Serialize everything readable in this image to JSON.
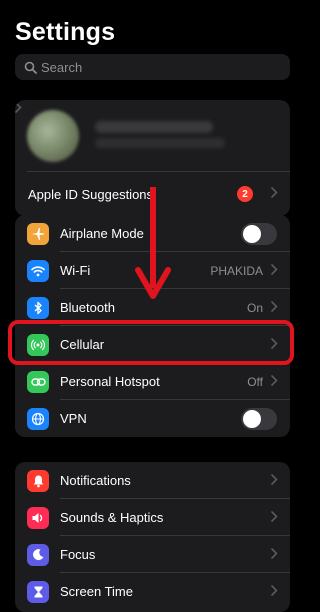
{
  "header": {
    "title": "Settings"
  },
  "search": {
    "placeholder": "Search"
  },
  "profile": {
    "suggestions_label": "Apple ID Suggestions",
    "badge": "2"
  },
  "connectivity": [
    {
      "label": "Airplane Mode",
      "icon": "airplane-icon",
      "color": "#f2a33a",
      "control": "toggle",
      "toggle_on": false
    },
    {
      "label": "Wi-Fi",
      "icon": "wifi-icon",
      "color": "#1a84ff",
      "value": "PHAKIDA"
    },
    {
      "label": "Bluetooth",
      "icon": "bluetooth-icon",
      "color": "#1a84ff",
      "value": "On"
    },
    {
      "label": "Cellular",
      "icon": "antenna-icon",
      "color": "#34c759"
    },
    {
      "label": "Personal Hotspot",
      "icon": "link-icon",
      "color": "#34c759",
      "value": "Off"
    },
    {
      "label": "VPN",
      "icon": "globe-icon",
      "color": "#1a84ff",
      "control": "toggle",
      "toggle_on": false
    }
  ],
  "general": [
    {
      "label": "Notifications",
      "icon": "bell-icon",
      "color": "#ff3b30"
    },
    {
      "label": "Sounds & Haptics",
      "icon": "speaker-icon",
      "color": "#ff2d55"
    },
    {
      "label": "Focus",
      "icon": "moon-icon",
      "color": "#5e5ce6"
    },
    {
      "label": "Screen Time",
      "icon": "hourglass-icon",
      "color": "#5e5ce6"
    }
  ],
  "annotation": {
    "highlight_color": "#e0141e",
    "arrow": "arrow-down",
    "highlighted_item": "Cellular"
  }
}
